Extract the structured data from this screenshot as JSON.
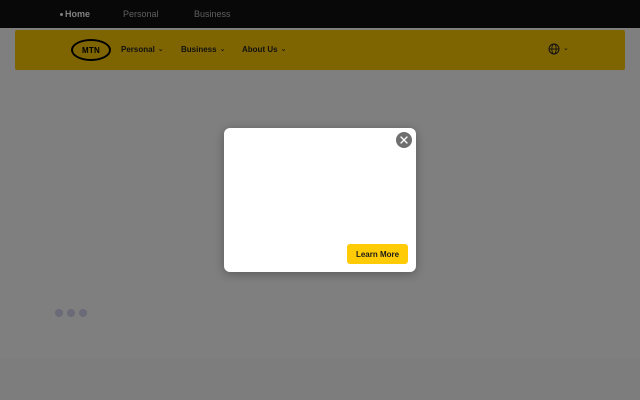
{
  "top_nav": {
    "items": [
      {
        "label": "Home",
        "active": true
      },
      {
        "label": "Personal",
        "active": false
      },
      {
        "label": "Business",
        "active": false
      }
    ]
  },
  "header": {
    "logo_text": "MTN",
    "nav": [
      {
        "label": "Personal"
      },
      {
        "label": "Business"
      },
      {
        "label": "About Us"
      }
    ],
    "language_icon": "globe-icon"
  },
  "modal": {
    "cta_label": "Learn More",
    "close_icon": "close-icon"
  },
  "loader": {
    "dots": 3
  },
  "colors": {
    "brand_yellow": "#ffcb05",
    "overlay": "rgba(0,0,0,0.5)",
    "top_strip": "#111111"
  }
}
